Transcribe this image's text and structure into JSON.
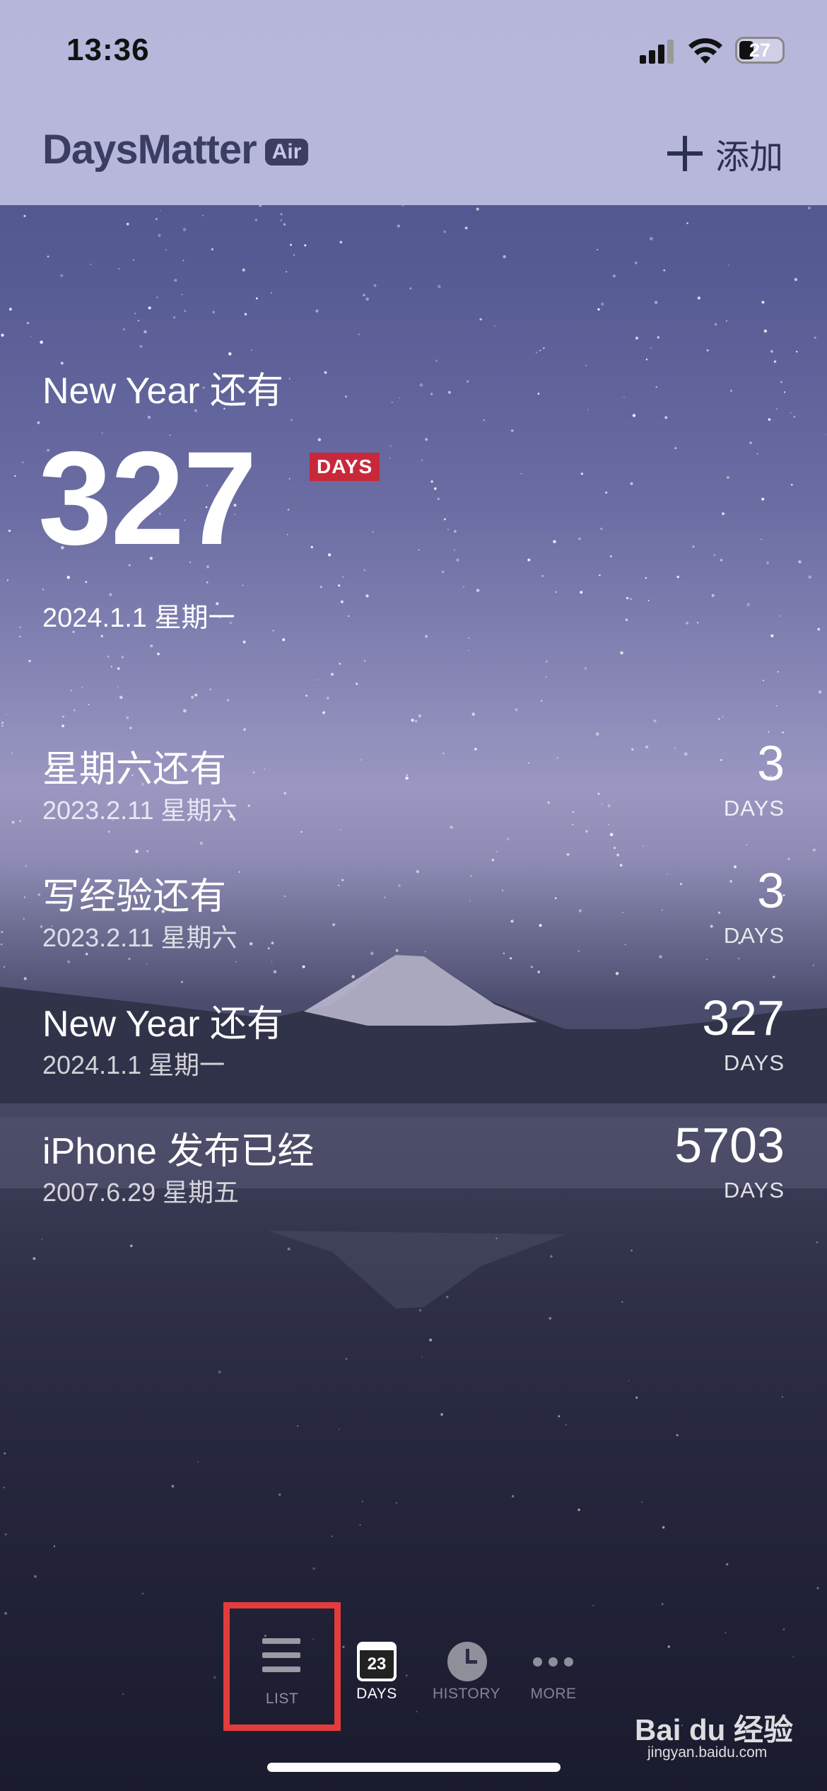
{
  "status_bar": {
    "time": "13:36",
    "battery": "27"
  },
  "header": {
    "app_name": "DaysMatter",
    "badge": "Air",
    "add_label": "添加"
  },
  "hero": {
    "title": "New Year 还有",
    "count": "327",
    "unit_badge": "DAYS",
    "date": "2024.1.1 星期一"
  },
  "events": [
    {
      "title": "星期六还有",
      "date": "2023.2.11 星期六",
      "count": "3",
      "unit": "DAYS"
    },
    {
      "title": "写经验还有",
      "date": "2023.2.11 星期六",
      "count": "3",
      "unit": "DAYS"
    },
    {
      "title": "New Year 还有",
      "date": "2024.1.1 星期一",
      "count": "327",
      "unit": "DAYS"
    },
    {
      "title": "iPhone 发布已经",
      "date": "2007.6.29 星期五",
      "count": "5703",
      "unit": "DAYS"
    }
  ],
  "tabs": {
    "list": "LIST",
    "days": "DAYS",
    "days_icon_number": "23",
    "history": "HISTORY",
    "more": "MORE"
  },
  "watermark": {
    "brand": "Bai du 经验",
    "url": "jingyan.baidu.com"
  },
  "colors": {
    "accent_red": "#c9283b",
    "highlight_box": "#e23c3c",
    "header_bg": "#bebee1"
  }
}
